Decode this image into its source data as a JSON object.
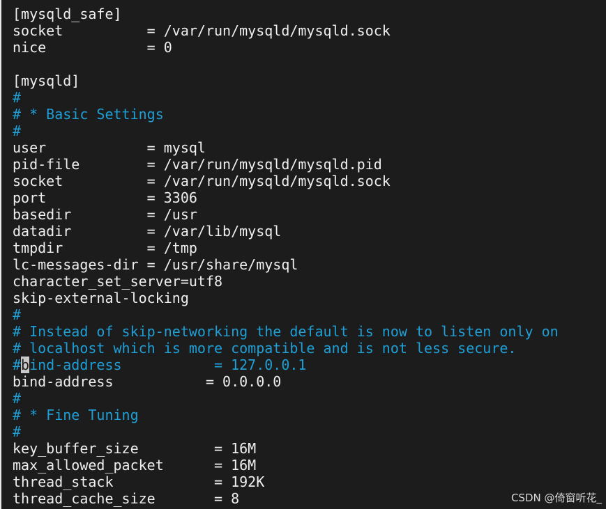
{
  "editor": {
    "lines": [
      {
        "text": "[mysqld_safe]",
        "type": "plain"
      },
      {
        "text": "socket          = /var/run/mysqld/mysqld.sock",
        "type": "plain"
      },
      {
        "text": "nice            = 0",
        "type": "plain"
      },
      {
        "text": "",
        "type": "plain"
      },
      {
        "text": "[mysqld]",
        "type": "plain"
      },
      {
        "text": "#",
        "type": "comment"
      },
      {
        "text": "# * Basic Settings",
        "type": "comment"
      },
      {
        "text": "#",
        "type": "comment"
      },
      {
        "text": "user            = mysql",
        "type": "plain"
      },
      {
        "text": "pid-file        = /var/run/mysqld/mysqld.pid",
        "type": "plain"
      },
      {
        "text": "socket          = /var/run/mysqld/mysqld.sock",
        "type": "plain"
      },
      {
        "text": "port            = 3306",
        "type": "plain"
      },
      {
        "text": "basedir         = /usr",
        "type": "plain"
      },
      {
        "text": "datadir         = /var/lib/mysql",
        "type": "plain"
      },
      {
        "text": "tmpdir          = /tmp",
        "type": "plain"
      },
      {
        "text": "lc-messages-dir = /usr/share/mysql",
        "type": "plain"
      },
      {
        "text": "character_set_server=utf8",
        "type": "plain"
      },
      {
        "text": "skip-external-locking",
        "type": "plain"
      },
      {
        "text": "#",
        "type": "comment"
      },
      {
        "text": "# Instead of skip-networking the default is now to listen only on",
        "type": "comment"
      },
      {
        "text": "# localhost which is more compatible and is not less secure.",
        "type": "comment"
      },
      {
        "text": "#bind-address           = 127.0.0.1",
        "type": "comment",
        "cursor": 1
      },
      {
        "text": "bind-address           = 0.0.0.0",
        "type": "plain"
      },
      {
        "text": "#",
        "type": "comment"
      },
      {
        "text": "# * Fine Tuning",
        "type": "comment"
      },
      {
        "text": "#",
        "type": "comment"
      },
      {
        "text": "key_buffer_size         = 16M",
        "type": "plain"
      },
      {
        "text": "max_allowed_packet      = 16M",
        "type": "plain"
      },
      {
        "text": "thread_stack            = 192K",
        "type": "plain"
      },
      {
        "text": "thread_cache_size       = 8",
        "type": "plain"
      }
    ]
  },
  "watermark": {
    "text": "CSDN @倚窗听花_"
  },
  "colors": {
    "background": "#1c1c1c",
    "text": "#eeeeee",
    "comment": "#1f9fd6",
    "cursor": "#c9c9c9"
  }
}
